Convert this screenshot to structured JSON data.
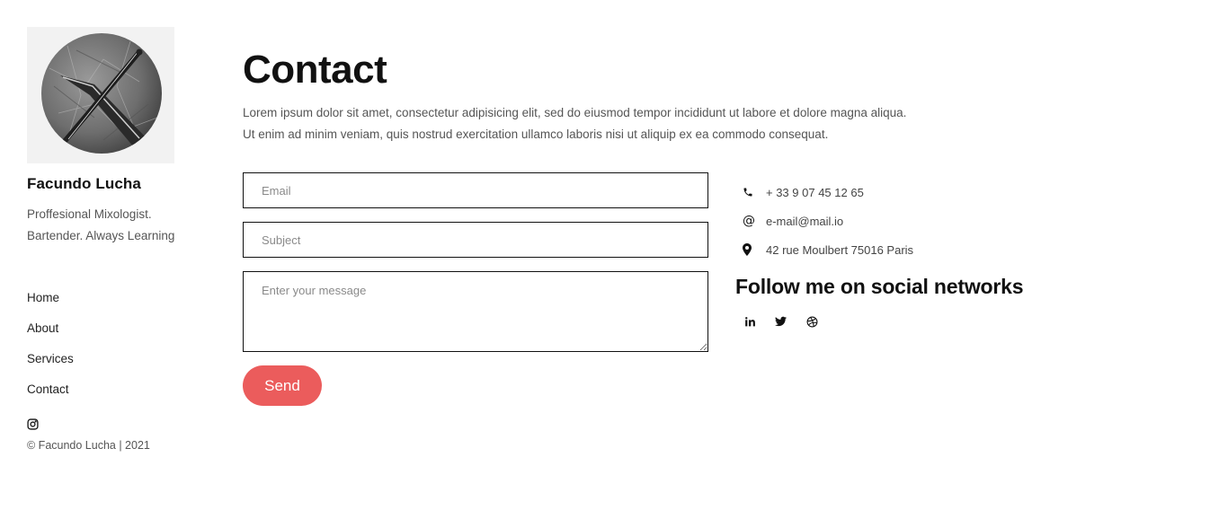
{
  "profile": {
    "name": "Facundo Lucha",
    "bio_line1": "Proffesional Mixologist.",
    "bio_line2": "Bartender. Always Learning"
  },
  "nav": {
    "items": [
      {
        "label": "Home"
      },
      {
        "label": "About"
      },
      {
        "label": "Services"
      },
      {
        "label": "Contact"
      }
    ]
  },
  "footer": {
    "copyright": "© Facundo Lucha | 2021",
    "icon": "instagram-icon"
  },
  "main": {
    "title": "Contact",
    "intro_line1": "Lorem ipsum dolor sit amet, consectetur adipisicing elit, sed do eiusmod tempor incididunt ut labore et dolore magna aliqua.",
    "intro_line2": "Ut enim ad minim veniam, quis nostrud exercitation ullamco laboris nisi ut aliquip ex ea commodo consequat."
  },
  "form": {
    "email_placeholder": "Email",
    "subject_placeholder": "Subject",
    "message_placeholder": "Enter your message",
    "send_label": "Send",
    "send_color": "#eb5c5c"
  },
  "contact_info": {
    "phone": "+ 33 9 07 45 12 65",
    "email": "e-mail@mail.io",
    "address": "42 rue Moulbert 75016 Paris"
  },
  "social": {
    "title": "Follow me on social networks",
    "icons": [
      "linkedin-icon",
      "twitter-icon",
      "dribbble-icon"
    ]
  }
}
